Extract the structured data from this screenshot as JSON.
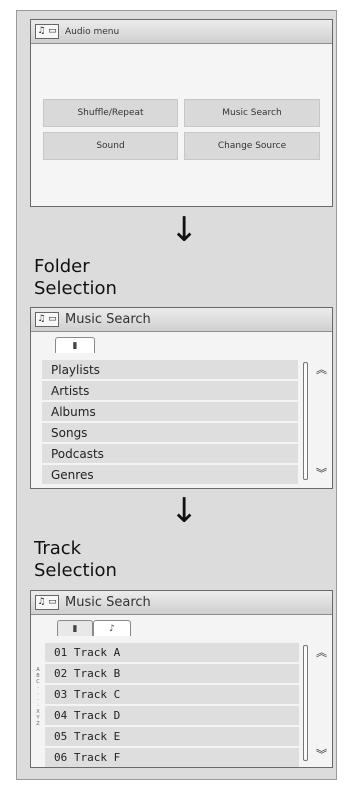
{
  "panel1": {
    "title": "Audio menu",
    "buttons": [
      "Shuffle/Repeat",
      "Music Search",
      "Sound",
      "Change Source"
    ]
  },
  "headings": {
    "folder": "Folder Selection",
    "track": "Track Selection"
  },
  "panel2": {
    "title": "Music Search",
    "tab_icon": "▮",
    "items": [
      "Playlists",
      "Artists",
      "Albums",
      "Songs",
      "Podcasts",
      "Genres"
    ]
  },
  "panel3": {
    "title": "Music Search",
    "tabs": [
      "▮",
      "♪"
    ],
    "alpha_index": [
      "A",
      "B",
      "C",
      "·",
      "·",
      "·",
      "·",
      "X",
      "Y",
      "Z"
    ],
    "items": [
      "01 Track A",
      "02 Track B",
      "03 Track C",
      "04 Track D",
      "05 Track E",
      "06 Track F"
    ]
  },
  "icons": {
    "source": "music-source-icon",
    "flow": "arrow-down-icon",
    "scroll_up": "double-chevron-up-icon",
    "scroll_down": "double-chevron-down-icon"
  }
}
